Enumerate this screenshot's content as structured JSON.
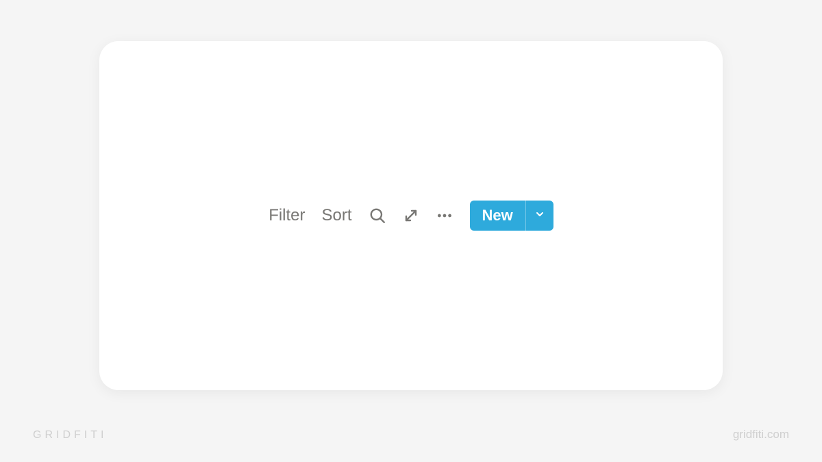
{
  "toolbar": {
    "filter_label": "Filter",
    "sort_label": "Sort",
    "new_label": "New"
  },
  "footer": {
    "brand": "GRIDFITI",
    "url": "gridfiti.com"
  },
  "colors": {
    "accent": "#2eaadc",
    "muted_text": "#787774",
    "footer_text": "#cfcfcf",
    "background": "#f5f5f5",
    "card": "#ffffff"
  }
}
